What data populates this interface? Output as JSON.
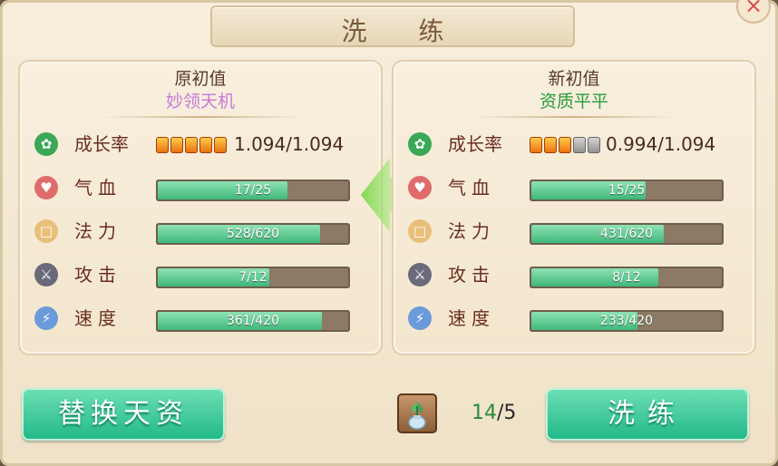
{
  "dialog": {
    "title": "洗 练",
    "close_label": "×"
  },
  "left_panel": {
    "title": "原初值",
    "subtitle": "妙领天机",
    "growth": {
      "label": "成长率",
      "boxes_filled": 5,
      "boxes_total": 5,
      "value_text": "1.094/1.094"
    },
    "stats": [
      {
        "label": "气血",
        "text": "17/25",
        "current": 17,
        "max": 25,
        "icon": "heart-icon",
        "icon_color": "#e06b6b"
      },
      {
        "label": "法力",
        "text": "528/620",
        "current": 528,
        "max": 620,
        "icon": "scroll-icon",
        "icon_color": "#e8c07a"
      },
      {
        "label": "攻击",
        "text": "7/12",
        "current": 7,
        "max": 12,
        "icon": "sword-icon",
        "icon_color": "#6a6a7a"
      },
      {
        "label": "速度",
        "text": "361/420",
        "current": 361,
        "max": 420,
        "icon": "lightning-icon",
        "icon_color": "#6a9ad8"
      }
    ]
  },
  "right_panel": {
    "title": "新初值",
    "subtitle": "资质平平",
    "growth": {
      "label": "成长率",
      "boxes_filled": 3,
      "boxes_total": 5,
      "value_text": "0.994/1.094"
    },
    "stats": [
      {
        "label": "气血",
        "text": "15/25",
        "current": 15,
        "max": 25,
        "icon": "heart-icon",
        "icon_color": "#e06b6b"
      },
      {
        "label": "法力",
        "text": "431/620",
        "current": 431,
        "max": 620,
        "icon": "scroll-icon",
        "icon_color": "#e8c07a"
      },
      {
        "label": "攻击",
        "text": "8/12",
        "current": 8,
        "max": 12,
        "icon": "sword-icon",
        "icon_color": "#6a6a7a"
      },
      {
        "label": "速度",
        "text": "233/420",
        "current": 233,
        "max": 420,
        "icon": "lightning-icon",
        "icon_color": "#6a9ad8"
      }
    ]
  },
  "buttons": {
    "replace_label": "替换天资",
    "wash_label": "洗练"
  },
  "item": {
    "icon": "potion-plant-icon",
    "count_have": "14",
    "count_sep_need": "/5"
  },
  "colors": {
    "accent_green": "#20b787",
    "bar_fill": "#3fb87a",
    "growth_icon": "#3aa857"
  }
}
